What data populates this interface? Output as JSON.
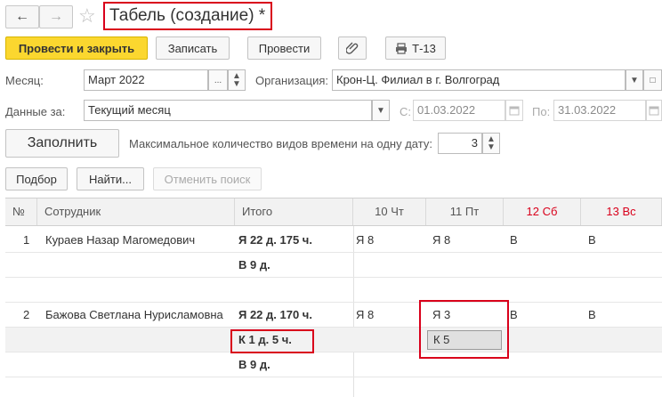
{
  "window": {
    "title": "Табель (создание) *"
  },
  "toolbar": {
    "post_close": "Провести и закрыть",
    "save": "Записать",
    "post": "Провести",
    "print": "Т-13"
  },
  "form": {
    "month_label": "Месяц:",
    "month_value": "Март 2022",
    "org_label": "Организация:",
    "org_value": "Крон-Ц. Филиал в г. Волгоград",
    "data_for_label": "Данные за:",
    "data_for_value": "Текущий месяц",
    "from_label": "С:",
    "from_value": "01.03.2022",
    "to_label": "По:",
    "to_value": "31.03.2022",
    "fill_button": "Заполнить",
    "max_types_label": "Максимальное количество видов времени на одну дату:",
    "max_types_value": "3"
  },
  "search": {
    "pick": "Подбор",
    "find": "Найти...",
    "cancel_search": "Отменить поиск"
  },
  "grid": {
    "columns": [
      "№",
      "Сотрудник",
      "Итого",
      "10 Чт",
      "11 Пт",
      "12 Сб",
      "13 Вс"
    ],
    "rows": [
      {
        "num": "1",
        "employee": "Кураев Назар Магомедович",
        "total": "Я 22 д. 175 ч.",
        "d10": "Я 8",
        "d11": "Я 8",
        "d12": "В",
        "d13": "В"
      },
      {
        "num": "",
        "employee": "",
        "total": "В 9 д.",
        "d10": "",
        "d11": "",
        "d12": "",
        "d13": ""
      },
      {
        "num": "",
        "employee": "",
        "total": "",
        "d10": "",
        "d11": "",
        "d12": "",
        "d13": ""
      },
      {
        "num": "2",
        "employee": "Бажова Светлана Нурисламовна",
        "total": "Я 22 д. 170 ч.",
        "d10": "Я 8",
        "d11": "Я 3",
        "d12": "В",
        "d13": "В"
      },
      {
        "num": "",
        "employee": "",
        "total": "К 1 д. 5 ч.",
        "d10": "",
        "d11": "К 5",
        "d12": "",
        "d13": ""
      },
      {
        "num": "",
        "employee": "",
        "total": "В 9 д.",
        "d10": "",
        "d11": "",
        "d12": "",
        "d13": ""
      }
    ]
  },
  "colors": {
    "accent_yellow": "#fbd72f",
    "highlight_red": "#d9001b",
    "weekend_red": "#d9001b"
  },
  "icons": {
    "back": "arrow-left-icon",
    "forward": "arrow-right-icon",
    "favorite": "star-icon",
    "attach": "paperclip-icon",
    "print": "printer-icon",
    "calendar": "calendar-icon"
  }
}
